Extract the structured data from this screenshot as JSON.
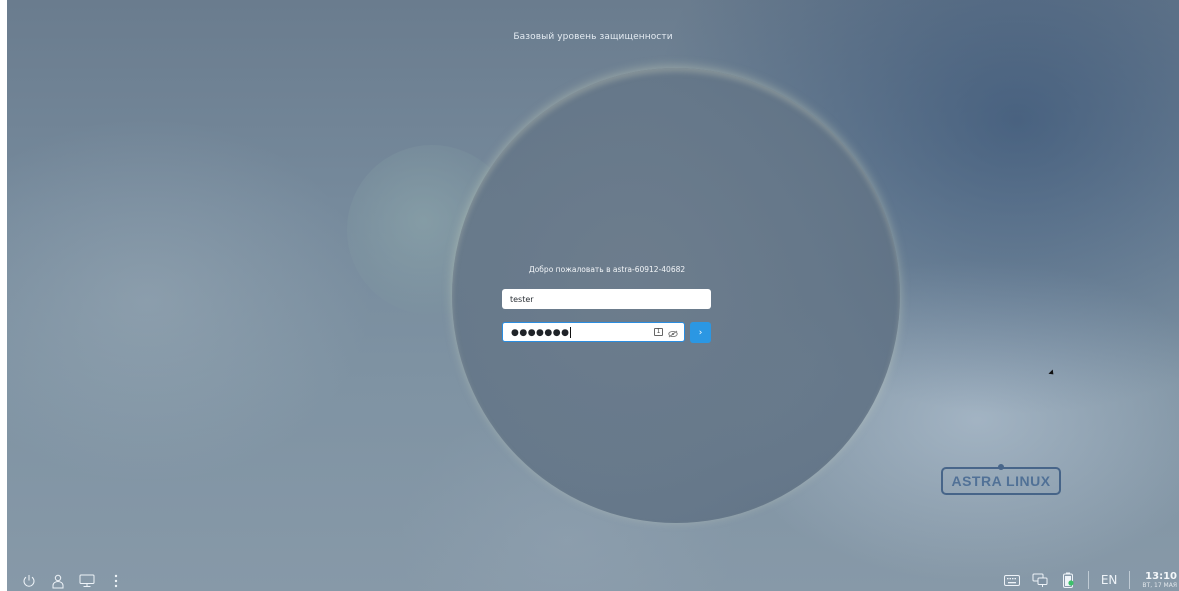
{
  "header": {
    "security_level": "Базовый уровень защищенности"
  },
  "login": {
    "welcome": "Добро пожаловать в astra-60912-40682",
    "username": "tester",
    "password_masked": "●●●●●●●",
    "keyboard_indicator": "1"
  },
  "branding": {
    "logo_text": "ASTRA LINUX"
  },
  "bottom_left": {
    "icons": [
      "power-icon",
      "user-icon",
      "display-icon",
      "more-icon"
    ]
  },
  "tray": {
    "icons": [
      "keyboard-icon",
      "network-icon",
      "battery-icon"
    ],
    "language": "EN",
    "time": "13:10",
    "date": "ВТ, 17 МАЯ"
  },
  "colors": {
    "accent": "#2b97e3",
    "logo": "#2d4f7a"
  }
}
